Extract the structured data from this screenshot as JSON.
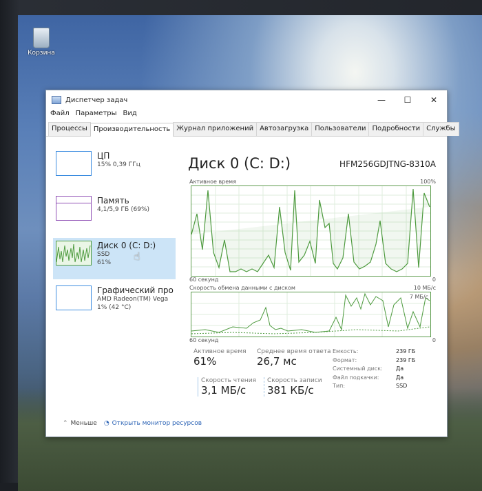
{
  "desktop": {
    "recycle_bin_label": "Корзина"
  },
  "window": {
    "title": "Диспетчер задач",
    "controls": [
      "—",
      "☐",
      "✕"
    ]
  },
  "menu": [
    "Файл",
    "Параметры",
    "Вид"
  ],
  "tabs": [
    "Процессы",
    "Производительность",
    "Журнал приложений",
    "Автозагрузка",
    "Пользователи",
    "Подробности",
    "Службы"
  ],
  "active_tab": "Производительность",
  "sidebar": {
    "items": [
      {
        "name": "ЦП",
        "line1": "15% 0,39 ГГц",
        "line2": ""
      },
      {
        "name": "Память",
        "line1": "4,1/5,9 ГБ (69%)",
        "line2": ""
      },
      {
        "name": "Диск 0 (C: D:)",
        "line1": "SSD",
        "line2": "61%"
      },
      {
        "name": "Графический про",
        "line1": "AMD Radeon(TM) Vega",
        "line2": "1% (42 °C)"
      }
    ]
  },
  "main": {
    "title": "Диск 0 (C: D:)",
    "model": "HFM256GDJTNG-8310A",
    "graph1": {
      "label": "Активное время",
      "max": "100%",
      "time": "60 секунд",
      "min": "0"
    },
    "graph2": {
      "label": "Скорость обмена данными с диском",
      "max": "10 МБ/с",
      "sub": "7 МБ/с",
      "time": "60 секунд",
      "min": "0"
    },
    "stats": {
      "active_time_label": "Активное время",
      "active_time": "61%",
      "response_label": "Среднее время ответа",
      "response": "26,7 мс",
      "read_label": "Скорость чтения",
      "read": "3,1 МБ/с",
      "write_label": "Скорость записи",
      "write": "381 КБ/с"
    },
    "props": {
      "keys": [
        "Емкость:",
        "Формат:",
        "Системный диск:",
        "Файл подкачки:",
        "Тип:"
      ],
      "values": [
        "239 ГБ",
        "239 ГБ",
        "Да",
        "Да",
        "SSD"
      ]
    }
  },
  "footer": {
    "less": "Меньше",
    "monitor": "Открыть монитор ресурсов"
  },
  "colors": {
    "disk_green": "#4d9a3e",
    "selection": "#cce4f7",
    "link": "#2a62b5"
  }
}
